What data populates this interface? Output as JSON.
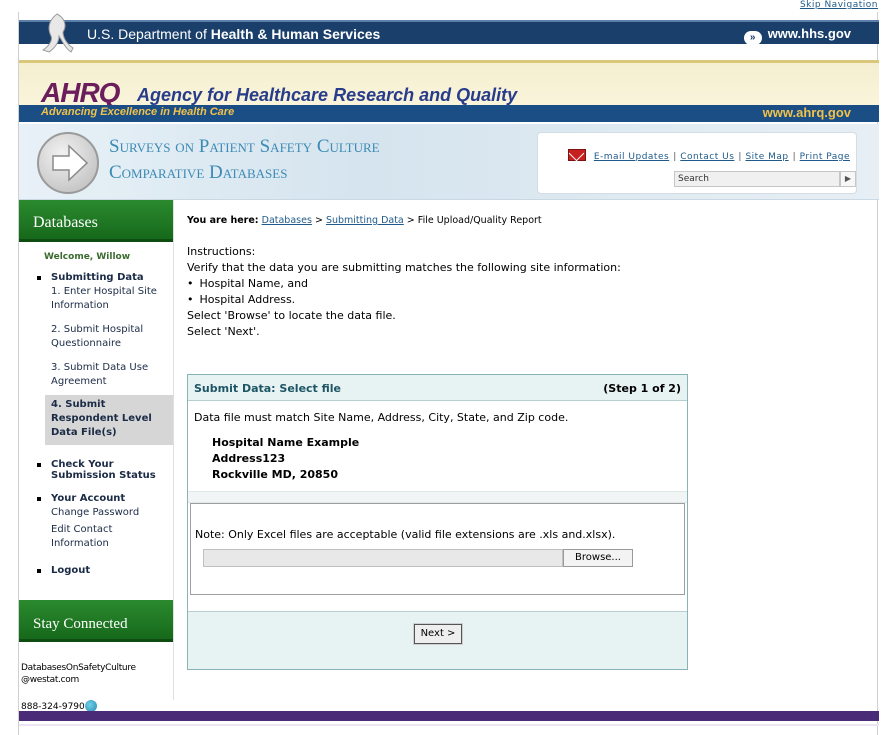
{
  "skip_nav": "Skip Navigation",
  "hhs": {
    "dept_prefix": "U.S. Department of ",
    "dept_bold": "Health & Human Services",
    "url": "www.hhs.gov"
  },
  "ahrq": {
    "logo": "AHRQ",
    "name": "Agency for Healthcare Research and Quality",
    "tagline": "Advancing Excellence in Health Care",
    "url": "www.ahrq.gov"
  },
  "sops": {
    "title_line1": "Surveys on Patient Safety Culture",
    "title_line2": "Comparative Databases"
  },
  "utility": {
    "email_updates": "E-mail Updates",
    "contact_us": "Contact Us",
    "site_map": "Site Map",
    "print_page": "Print Page",
    "search_placeholder": "Search"
  },
  "sidebar": {
    "heading": "Databases",
    "welcome": "Welcome, Willow",
    "submitting_data": "Submitting Data",
    "step1": "1. Enter Hospital Site Information",
    "step2": "2. Submit Hospital Questionnaire",
    "step3": "3. Submit Data Use Agreement",
    "step4": "4. Submit Respondent Level Data File(s)",
    "check_status": "Check Your Submission Status",
    "your_account": "Your Account",
    "change_password": "Change Password",
    "edit_contact": "Edit Contact Information",
    "logout": "Logout",
    "stay_connected": "Stay Connected",
    "email_line1": "DatabasesOnSafetyCulture",
    "email_line2": "@westat.com",
    "phone": "888-324-9790"
  },
  "breadcrumb": {
    "label": "You are here:",
    "crumb1": "Databases",
    "crumb2": "Submitting Data",
    "current": "File Upload/Quality Report",
    "sep": ">"
  },
  "instructions": {
    "heading": "Instructions:",
    "line1": "Verify that the data you are submitting matches the following site information:",
    "bullet1": "Hospital Name, and",
    "bullet2": "Hospital Address.",
    "line2": "Select 'Browse' to locate the data file.",
    "line3": "Select 'Next'."
  },
  "panel": {
    "title": "Submit Data: Select file",
    "step": "(Step 1 of 2)",
    "note": "Data file must match Site Name, Address, City, State, and Zip code.",
    "hospital_name": "Hospital Name Example",
    "address": "Address123",
    "city_state_zip": "Rockville MD, 20850",
    "upload_note": "Note: Only Excel files are acceptable (valid file extensions are .xls and.xlsx).",
    "browse_label": "Browse...",
    "next_label": "Next >"
  }
}
